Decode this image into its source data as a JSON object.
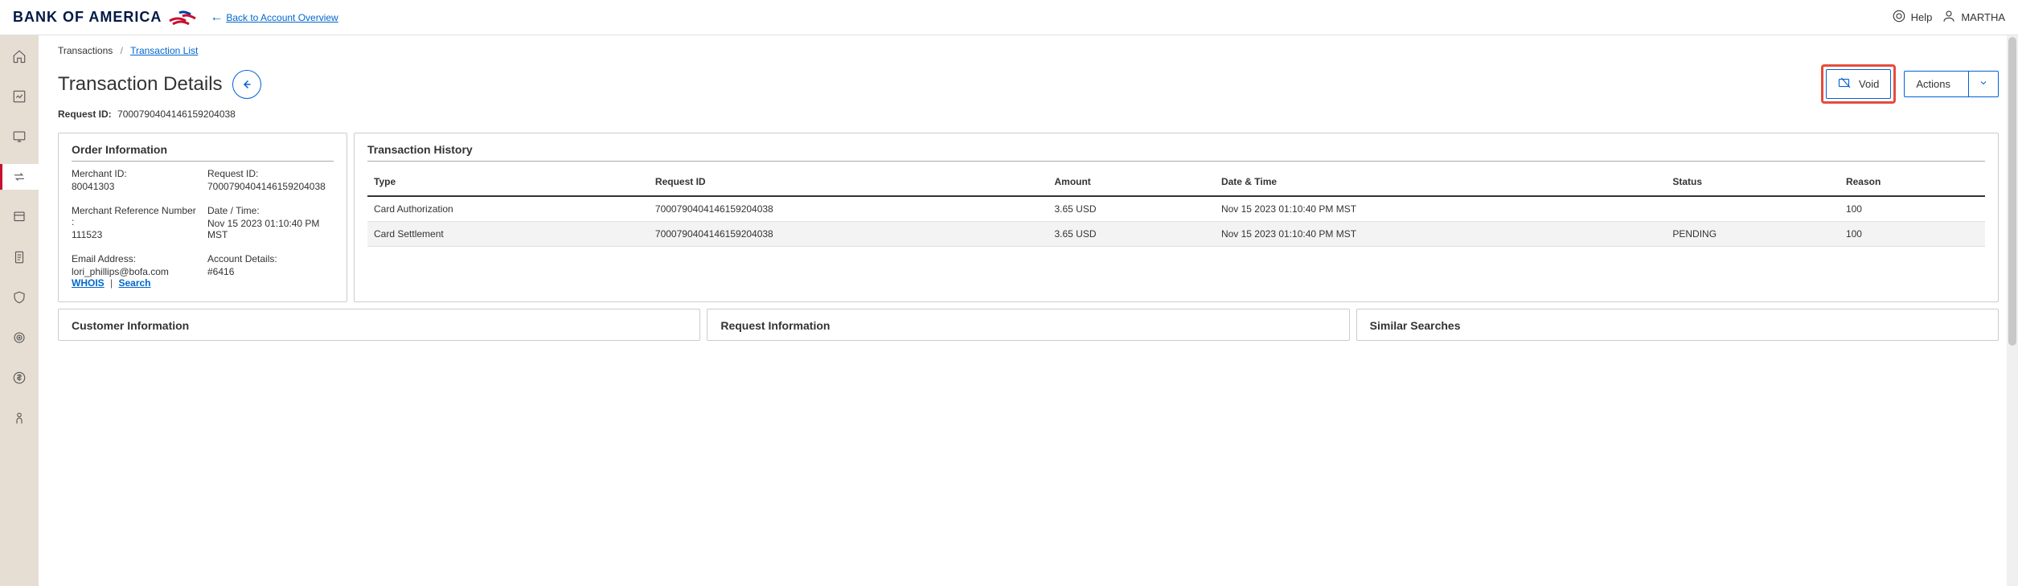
{
  "header": {
    "logo_text": "BANK OF AMERICA",
    "back_link": "Back to Account Overview",
    "help": "Help",
    "user": "MARTHA"
  },
  "breadcrumb": {
    "root": "Transactions",
    "current": "Transaction List"
  },
  "page": {
    "title": "Transaction Details",
    "request_id_label": "Request ID:",
    "request_id": "7000790404146159204038",
    "void_label": "Void",
    "actions_label": "Actions"
  },
  "order_info": {
    "title": "Order Information",
    "merchant_id_label": "Merchant ID:",
    "merchant_id": "80041303",
    "request_id_label": "Request ID:",
    "request_id": "7000790404146159204038",
    "merchant_ref_label": "Merchant Reference Number :",
    "merchant_ref": "111523",
    "date_time_label": "Date / Time:",
    "date_time": "Nov 15 2023 01:10:40 PM MST",
    "email_label": "Email Address:",
    "email": "lori_phillips@bofa.com",
    "whois": "WHOIS",
    "search": "Search",
    "account_details_label": "Account Details:",
    "account_details": "#6416"
  },
  "history": {
    "title": "Transaction History",
    "columns": {
      "type": "Type",
      "request_id": "Request ID",
      "amount": "Amount",
      "date_time": "Date & Time",
      "status": "Status",
      "reason": "Reason"
    },
    "rows": [
      {
        "type": "Card Authorization",
        "request_id": "7000790404146159204038",
        "amount": "3.65 USD",
        "date_time": "Nov 15 2023 01:10:40 PM MST",
        "status": "",
        "reason": "100"
      },
      {
        "type": "Card Settlement",
        "request_id": "7000790404146159204038",
        "amount": "3.65 USD",
        "date_time": "Nov 15 2023 01:10:40 PM MST",
        "status": "PENDING",
        "reason": "100"
      }
    ]
  },
  "bottom": {
    "customer": "Customer Information",
    "request": "Request Information",
    "similar": "Similar Searches"
  }
}
